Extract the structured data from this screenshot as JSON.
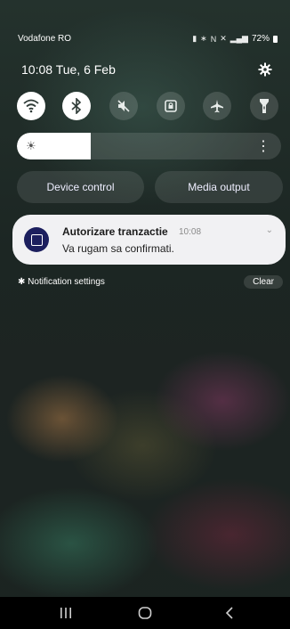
{
  "status_bar": {
    "carrier": "Vodafone RO",
    "battery": "72%",
    "icons": [
      "sim-icon",
      "bluetooth-icon",
      "nfc-icon",
      "mute-icon",
      "4g-signal-icon",
      "signal-icon",
      "battery-icon"
    ]
  },
  "header": {
    "time": "10:08",
    "date": "Tue, 6 Feb"
  },
  "quick_toggles": [
    {
      "name": "wifi",
      "state": "on"
    },
    {
      "name": "bluetooth",
      "state": "on"
    },
    {
      "name": "sound-mute",
      "state": "off"
    },
    {
      "name": "auto-rotate-lock",
      "state": "off"
    },
    {
      "name": "airplane-mode",
      "state": "off"
    },
    {
      "name": "flashlight",
      "state": "off"
    }
  ],
  "brightness": {
    "level": 0.28
  },
  "buttons": {
    "device_control": "Device control",
    "media_output": "Media output"
  },
  "notification": {
    "title": "Autorizare tranzactie",
    "time": "10:08",
    "body": "Va rugam sa confirmati."
  },
  "footer": {
    "notification_settings": "Notification settings",
    "clear": "Clear"
  },
  "colors": {
    "app_icon": "#1c1f5e",
    "tile_on": "#ffffff",
    "notification_bg": "#f1f1f3"
  }
}
